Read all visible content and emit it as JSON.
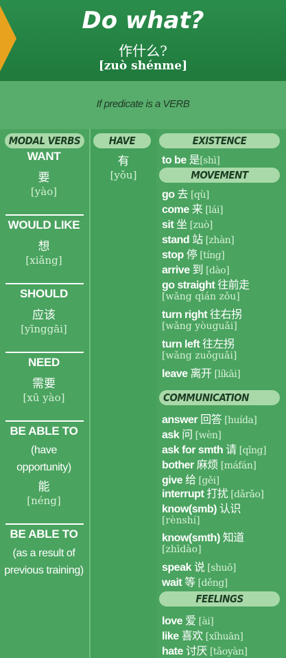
{
  "header": {
    "title": "Do what?",
    "subtitle_zh": "作什么?",
    "subtitle_pinyin": "[zuò shénme]",
    "predicate_note": "If predicate is a VERB"
  },
  "modal": {
    "pill": "MODAL VERBS",
    "want_en": "WANT",
    "want_zh": "要",
    "want_py": "[yào]",
    "would_en": "WOULD LIKE",
    "would_zh": "想",
    "would_py": "[xiǎng]",
    "should_en": "SHOULD",
    "should_zh": "应该",
    "should_py": "[yīnggāi]",
    "need_en": "NEED",
    "need_zh": "需要",
    "need_py": "[xū yào]",
    "able1_en": "BE ABLE TO",
    "able1_note1": "(have",
    "able1_note2": "opportunity)",
    "able1_zh": "能",
    "able1_py": "[néng]",
    "able2_en": "BE ABLE TO",
    "able2_note1": "(as a result of",
    "able2_note2": "previous training)"
  },
  "have": {
    "pill": "HAVE",
    "zh": "有",
    "py": "[yǒu]"
  },
  "existence": {
    "pill": "EXISTENCE",
    "en": "to be",
    "zh": "是",
    "py": "[shì]"
  },
  "movement": {
    "pill": "MOVEMENT",
    "go_en": "go",
    "go_zh": "去",
    "go_py": "[qù]",
    "come_en": "come",
    "come_zh": "来",
    "come_py": "[lái]",
    "sit_en": "sit",
    "sit_zh": "坐",
    "sit_py": "[zuò]",
    "stand_en": "stand",
    "stand_zh": "站",
    "stand_py": "[zhàn]",
    "stop_en": "stop",
    "stop_zh": "停",
    "stop_py": "[tíng]",
    "arrive_en": "arrive",
    "arrive_zh": "到",
    "arrive_py": "[dào]",
    "straight_en": "go straight",
    "straight_zh": "往前走",
    "straight_py": "[wǎng qián zǒu]",
    "right_en": "turn right",
    "right_zh": "往右拐",
    "right_py": "[wǎng yòuguǎi]",
    "left_en": "turn left",
    "left_zh": "往左拐",
    "left_py": "[wǎng zuǒguǎi]",
    "leave_en": "leave",
    "leave_zh": "离开",
    "leave_py": "[líkāi]"
  },
  "communication": {
    "pill": "COMMUNICATION",
    "answer_en": "answer",
    "answer_zh": "回答",
    "answer_py": "[huída]",
    "ask_en": "ask",
    "ask_zh": "问",
    "ask_py": "[wèn]",
    "askfor_en": "ask for smth",
    "askfor_zh": "请",
    "askfor_py": "[qǐng]",
    "bother_en": "bother",
    "bother_zh": "麻烦",
    "bother_py": "[máfán]",
    "give_en": "give",
    "give_zh": "给",
    "give_py": "[gěi]",
    "interrupt_en": "interrupt",
    "interrupt_zh": "打扰",
    "interrupt_py": "[dǎrǎo]",
    "knowsmb_en": "know(smb)",
    "knowsmb_zh": "认识",
    "knowsmb_py": "[rènshí]",
    "knowsmth_en": "know(smth)",
    "knowsmth_zh": "知道",
    "knowsmth_py": "[zhīdào]",
    "speak_en": "speak",
    "speak_zh": "说",
    "speak_py": "[shuō]",
    "wait_en": "wait",
    "wait_zh": "等",
    "wait_py": "[děng]"
  },
  "feelings": {
    "pill": "FEELINGS",
    "love_en": "love",
    "love_zh": "爱",
    "love_py": "[ài]",
    "like_en": "like",
    "like_zh": "喜欢",
    "like_py": "[xǐhuān]",
    "hate_en": "hate",
    "hate_zh": "讨厌",
    "hate_py": "[tǎoyàn]"
  }
}
